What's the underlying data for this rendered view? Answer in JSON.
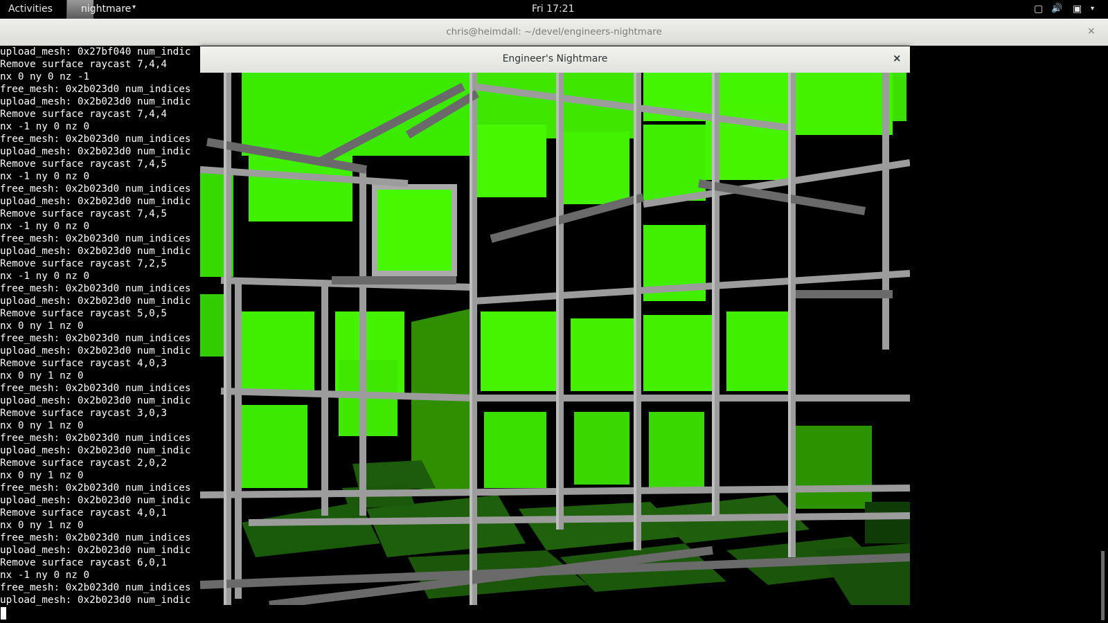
{
  "topbar": {
    "activities": "Activities",
    "app_name": "nightmare",
    "clock": "Fri 17:21"
  },
  "terminal": {
    "title": "chris@heimdall: ~/devel/engineers-nightmare",
    "lines": [
      "upload_mesh: 0x27bf040 num_indic",
      "Remove surface raycast 7,4,4",
      "nx 0 ny 0 nz -1",
      "free_mesh: 0x2b023d0 num_indices",
      "upload_mesh: 0x2b023d0 num_indic",
      "Remove surface raycast 7,4,4",
      "nx -1 ny 0 nz 0",
      "free_mesh: 0x2b023d0 num_indices",
      "upload_mesh: 0x2b023d0 num_indic",
      "Remove surface raycast 7,4,5",
      "nx -1 ny 0 nz 0",
      "free_mesh: 0x2b023d0 num_indices",
      "upload_mesh: 0x2b023d0 num_indic",
      "Remove surface raycast 7,4,5",
      "nx -1 ny 0 nz 0",
      "free_mesh: 0x2b023d0 num_indices",
      "upload_mesh: 0x2b023d0 num_indic",
      "Remove surface raycast 7,2,5",
      "nx -1 ny 0 nz 0",
      "free_mesh: 0x2b023d0 num_indices",
      "upload_mesh: 0x2b023d0 num_indic",
      "Remove surface raycast 5,0,5",
      "nx 0 ny 1 nz 0",
      "free_mesh: 0x2b023d0 num_indices",
      "upload_mesh: 0x2b023d0 num_indic",
      "Remove surface raycast 4,0,3",
      "nx 0 ny 1 nz 0",
      "free_mesh: 0x2b023d0 num_indices",
      "upload_mesh: 0x2b023d0 num_indic",
      "Remove surface raycast 3,0,3",
      "nx 0 ny 1 nz 0",
      "free_mesh: 0x2b023d0 num_indices",
      "upload_mesh: 0x2b023d0 num_indic",
      "Remove surface raycast 2,0,2",
      "nx 0 ny 1 nz 0",
      "free_mesh: 0x2b023d0 num_indices",
      "upload_mesh: 0x2b023d0 num_indic",
      "Remove surface raycast 4,0,1",
      "nx 0 ny 1 nz 0",
      "free_mesh: 0x2b023d0 num_indices",
      "upload_mesh: 0x2b023d0 num_indic",
      "Remove surface raycast 6,0,1",
      "nx -1 ny 0 nz 0",
      "free_mesh: 0x2b023d0 num_indices",
      "upload_mesh: 0x2b023d0 num_indic"
    ]
  },
  "game": {
    "title": "Engineer's Nightmare"
  },
  "icons": {
    "close": "×",
    "caret": "▾",
    "window": "▢",
    "volume": "🔊",
    "battery": "▣",
    "tray_caret": "▾"
  },
  "colors": {
    "panel_green": "#44ff00",
    "floor_green": "#1e5a0a",
    "frame_gray": "#9a9a9a"
  }
}
